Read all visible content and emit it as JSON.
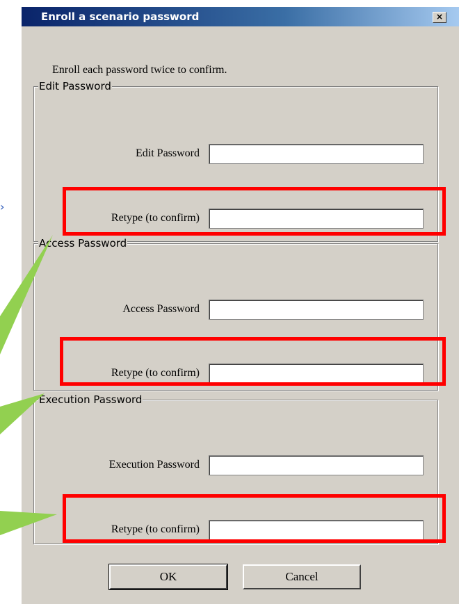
{
  "window": {
    "title": "Enroll a scenario password",
    "close_glyph": "×"
  },
  "instruction": "Enroll each password twice to confirm.",
  "groups": {
    "edit": {
      "legend": "Edit Password",
      "label1": "Edit Password",
      "label2": "Retype (to confirm)",
      "value1": "",
      "value2": ""
    },
    "access": {
      "legend": "Access Password",
      "label1": "Access Password",
      "label2": "Retype (to confirm)",
      "value1": "",
      "value2": ""
    },
    "execution": {
      "legend": "Execution Password",
      "label1": "Execution Password",
      "label2": "Retype (to confirm)",
      "value1": "",
      "value2": ""
    }
  },
  "buttons": {
    "ok": "OK",
    "cancel": "Cancel"
  },
  "annotations": {
    "highlight_color": "#ff0000",
    "callout_color": "#92d050",
    "arrow_glyph": "›"
  },
  "colors": {
    "dialog_bg": "#d4d0c8",
    "titlebar_start": "#0a246a",
    "titlebar_end": "#a6caf0"
  }
}
